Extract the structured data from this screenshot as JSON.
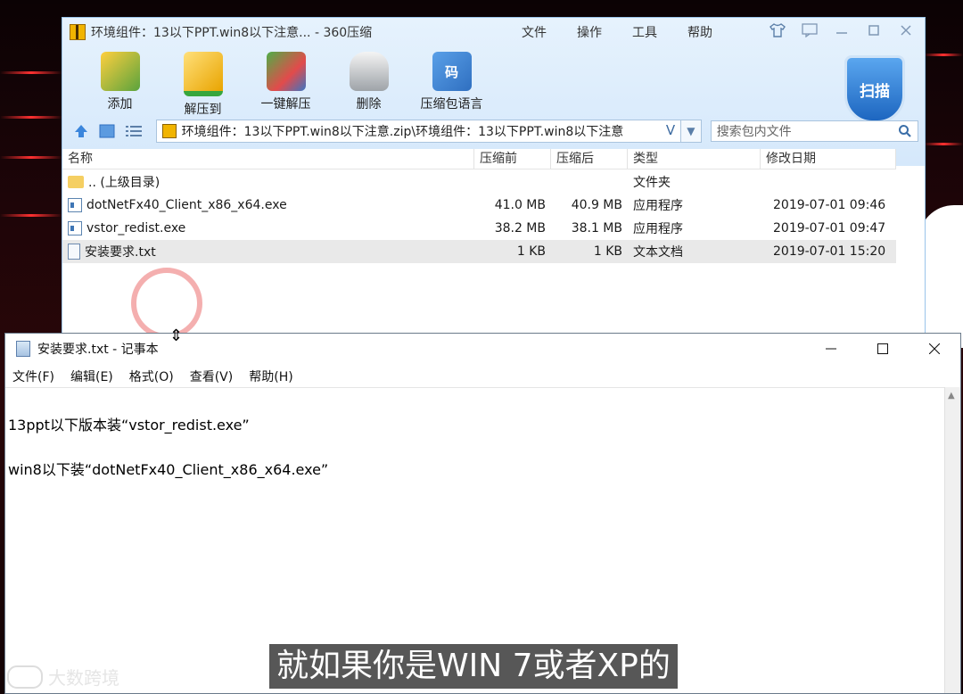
{
  "zip": {
    "title": "环境组件：13以下PPT.win8以下注意... - 360压缩",
    "menu": [
      "文件",
      "操作",
      "工具",
      "帮助"
    ],
    "tools": [
      {
        "label": "添加",
        "icon": "add-archive-icon"
      },
      {
        "label": "解压到",
        "icon": "extract-folder-icon"
      },
      {
        "label": "一键解压",
        "icon": "one-click-extract-icon"
      },
      {
        "label": "删除",
        "icon": "trash-bin-icon"
      },
      {
        "label": "压缩包语言",
        "icon": "archive-language-icon",
        "glyph": "码"
      }
    ],
    "scan_label": "扫描",
    "address": "环境组件：13以下PPT.win8以下注意.zip\\环境组件：13以下PPT.win8以下注意",
    "search_placeholder": "搜索包内文件",
    "columns": [
      "名称",
      "压缩前",
      "压缩后",
      "类型",
      "修改日期"
    ],
    "rows": [
      {
        "name": ".. (上级目录)",
        "icon": "folder-icon",
        "size": "",
        "packed": "",
        "type": "文件夹",
        "date": ""
      },
      {
        "name": "dotNetFx40_Client_x86_x64.exe",
        "icon": "exe-icon",
        "size": "41.0 MB",
        "packed": "40.9 MB",
        "type": "应用程序",
        "date": "2019-07-01 09:46"
      },
      {
        "name": "vstor_redist.exe",
        "icon": "exe-icon",
        "size": "38.2 MB",
        "packed": "38.1 MB",
        "type": "应用程序",
        "date": "2019-07-01 09:47"
      },
      {
        "name": "安装要求.txt",
        "icon": "text-file-icon",
        "size": "1 KB",
        "packed": "1 KB",
        "type": "文本文档",
        "date": "2019-07-01 15:20"
      }
    ]
  },
  "notepad": {
    "title": "安装要求.txt - 记事本",
    "menu": [
      "文件(F)",
      "编辑(E)",
      "格式(O)",
      "查看(V)",
      "帮助(H)"
    ],
    "lines": [
      "13ppt以下版本装“vstor_redist.exe”",
      "win8以下装“dotNetFx40_Client_x86_x64.exe”"
    ]
  },
  "subtitle": "就如果你是WIN 7或者XP的",
  "watermark": "大数跨境"
}
